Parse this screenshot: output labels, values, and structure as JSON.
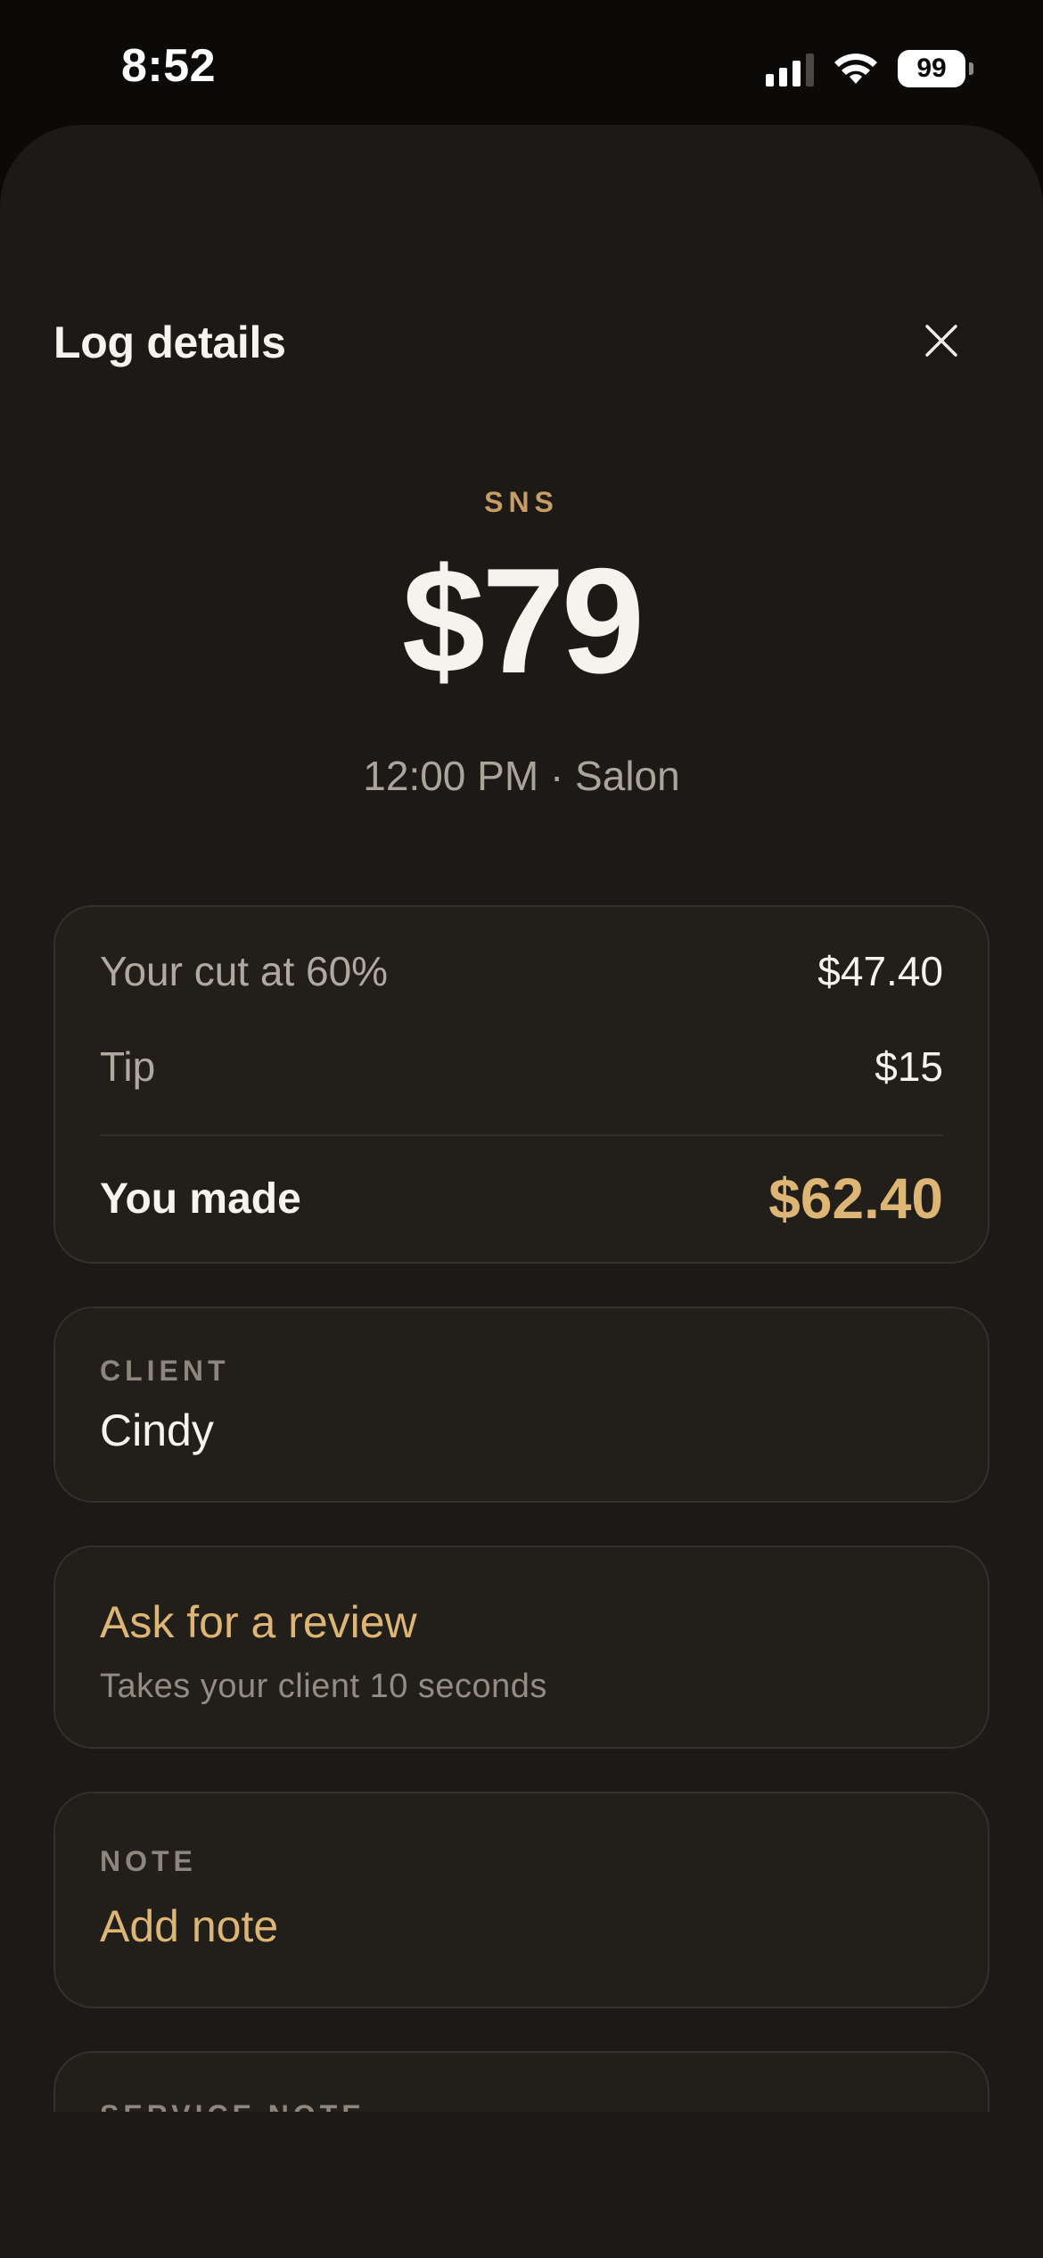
{
  "status_bar": {
    "time": "8:52",
    "battery": "99",
    "icons": [
      "signal-icon",
      "wifi-icon",
      "battery-icon"
    ]
  },
  "sheet": {
    "title": "Log details",
    "close_icon": "close-icon"
  },
  "service": {
    "name": "SNS",
    "price": "$79",
    "meta": "12:00 PM · Salon"
  },
  "earnings": {
    "cut_label": "Your cut at 60%",
    "cut_value": "$47.40",
    "tip_label": "Tip",
    "tip_value": "$15",
    "total_label": "You made",
    "total_value": "$62.40"
  },
  "client": {
    "label": "CLIENT",
    "name": "Cindy"
  },
  "review": {
    "title": "Ask for a review",
    "subtitle": "Takes your client 10 seconds"
  },
  "note": {
    "label": "NOTE",
    "action": "Add note"
  },
  "service_note": {
    "label": "SERVICE NOTE"
  },
  "colors": {
    "background": "#0b0a09",
    "sheet": "#1c1917",
    "card": "#221e1a",
    "accent_gold": "#ddb574",
    "service_label": "#c79d63"
  }
}
